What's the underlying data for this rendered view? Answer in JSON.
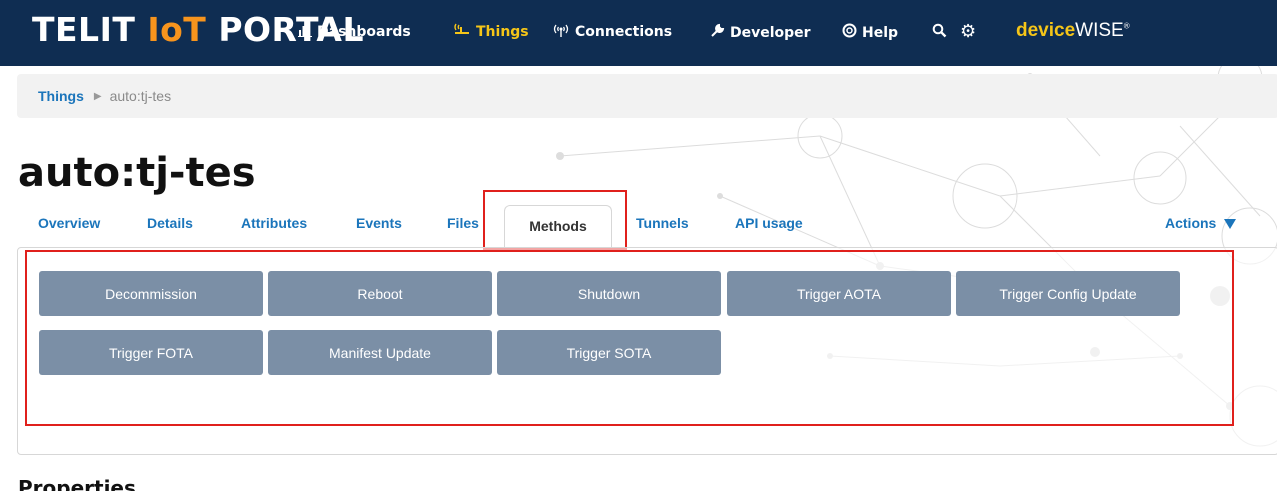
{
  "topbar": {
    "logo_main": "TELIT ",
    "logo_iot": "IoT",
    "logo_rest": " PORTAL",
    "nav": [
      {
        "label": "Dashboards",
        "icon": "bar-chart-icon"
      },
      {
        "label": "Things",
        "icon": "things-icon",
        "active": true
      },
      {
        "label": "Connections",
        "icon": "antenna-icon"
      },
      {
        "label": "Developer",
        "icon": "wrench-icon"
      },
      {
        "label": "Help",
        "icon": "lifebuoy-icon"
      }
    ],
    "search_icon": "search-icon",
    "settings_icon": "gear-icon",
    "brand_device": "device",
    "brand_wise": "WISE",
    "brand_mark": "®"
  },
  "breadcrumb": {
    "root": "Things",
    "current": "auto:tj-tes"
  },
  "page": {
    "title": "auto:tj-tes"
  },
  "tabs": {
    "items": [
      "Overview",
      "Details",
      "Attributes",
      "Events",
      "Files",
      "Methods",
      "Tunnels",
      "API usage"
    ],
    "active": "Methods",
    "actions_label": "Actions"
  },
  "methods": {
    "buttons": [
      "Decommission",
      "Reboot",
      "Shutdown",
      "Trigger AOTA",
      "Trigger Config Update",
      "Trigger FOTA",
      "Manifest Update",
      "Trigger SOTA"
    ]
  },
  "sections": {
    "properties_title": "Properties"
  },
  "colors": {
    "topbar": "#0f2d52",
    "accent_orange": "#f7941d",
    "accent_yellow": "#f5c518",
    "link_blue": "#1b75bb",
    "method_button": "#7b8fa6",
    "highlight_red": "#e0201c"
  }
}
